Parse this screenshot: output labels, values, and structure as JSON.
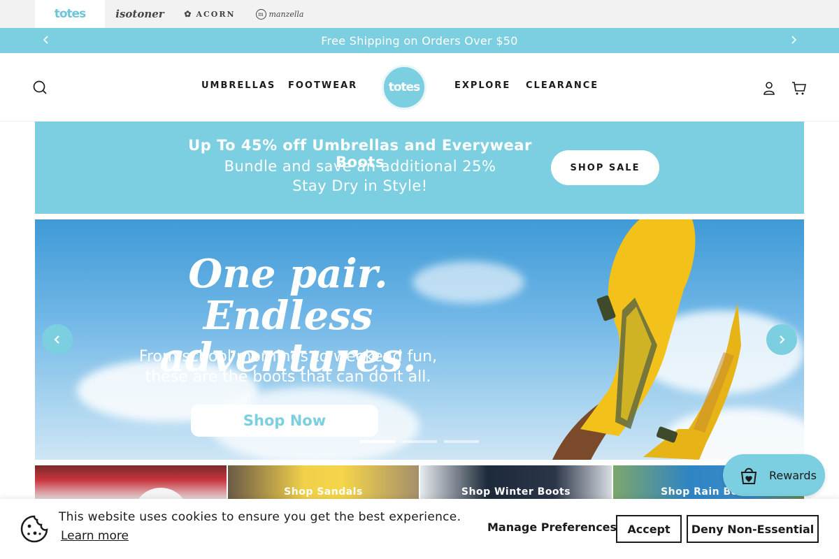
{
  "brands": [
    {
      "label": "totes",
      "active": true
    },
    {
      "label": "isotoner",
      "active": false
    },
    {
      "label": "ACORN",
      "active": false
    },
    {
      "label": "manzella",
      "active": false
    }
  ],
  "announcement": {
    "text": "Free Shipping on Orders Over $50",
    "prev_icon": "chevron-left-icon",
    "next_icon": "chevron-right-icon"
  },
  "header": {
    "logo_text": "totes",
    "nav_left": [
      "UMBRELLAS",
      "FOOTWEAR"
    ],
    "nav_right": [
      "EXPLORE",
      "CLEARANCE"
    ],
    "icons": [
      "search-icon",
      "account-icon",
      "cart-icon"
    ]
  },
  "promo": {
    "line1": "Up To 45% off Umbrellas and Everywear Boots",
    "line2": "Bundle and save an additional 25%",
    "line3": "Stay Dry in Style!",
    "button": "SHOP SALE"
  },
  "hero": {
    "headline_1": "One pair. Endless",
    "headline_2": "adventures.",
    "sub_1": "From school mornings to weekend fun,",
    "sub_2": "these are the boots that can do it all.",
    "button": "Shop Now",
    "slide_count": 3,
    "active_slide": 1
  },
  "tiles": [
    {
      "label": ""
    },
    {
      "label": "Shop Sandals"
    },
    {
      "label": "Shop Winter Boots"
    },
    {
      "label": "Shop Rain Boots"
    }
  ],
  "rewards": {
    "label": "Rewards",
    "icon": "gift-bag-icon"
  },
  "cookie": {
    "message": "This website uses cookies to ensure you get the best experience.",
    "learn_more": "Learn more",
    "manage": "Manage Preferences",
    "accept": "Accept",
    "deny": "Deny Non-Essential",
    "icon": "cookie-icon"
  },
  "colors": {
    "accent": "#7bcfe0",
    "boot_yellow": "#f3c21a",
    "text": "#1b1b1b"
  }
}
